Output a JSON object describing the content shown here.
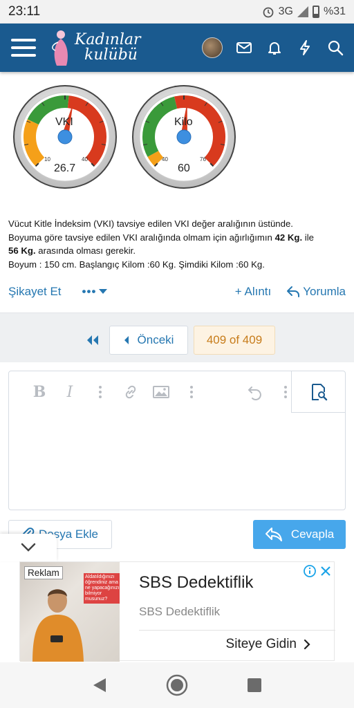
{
  "status_bar": {
    "time": "23:11",
    "network": "3G",
    "battery": "%31"
  },
  "header": {
    "logo_line1": "Kadınlar",
    "logo_line2": "kulübü",
    "brand_color": "#1a5a8f",
    "icons": [
      "menu-icon",
      "avatar",
      "envelope-icon",
      "bell-icon",
      "bolt-icon",
      "search-icon"
    ]
  },
  "gauges": [
    {
      "label": "VKI",
      "min_label": "10",
      "max_label": "40",
      "value": "26.7",
      "needle_fraction": 0.55
    },
    {
      "label": "Kilo",
      "min_label": "40",
      "max_label": "76",
      "value": "60",
      "needle_fraction": 0.52
    }
  ],
  "message": {
    "line1": "Vücut Kitle İndeksim (VKI) tavsiye edilen VKI değer aralığının üstünde.",
    "line2_a": "Boyuma göre tavsiye edilen VKI aralığında olmam için ağırlığımın ",
    "line2_b": "42 Kg.",
    "line2_c": " ile",
    "line3_a": "56 Kg.",
    "line3_b": " arasında olması gerekir.",
    "line4": "Boyum : 150 cm. Başlangıç Kilom :60 Kg. Şimdiki Kilom :60 Kg."
  },
  "actions": {
    "report": "Şikayet Et",
    "more": "•••",
    "quote": "+ Alıntı",
    "reply": "Yorumla"
  },
  "pager": {
    "prev_label": "Önceki",
    "current_label": "409 of 409"
  },
  "editor": {
    "bold": "B",
    "italic": "I"
  },
  "buttons": {
    "attach": "Dosya Ekle",
    "submit": "Cevapla",
    "accent": "#47a7eb"
  },
  "ad": {
    "tag": "Reklam",
    "image_text": "Aldatıldığınızı öğrendiniz ama ne yapacağınızı bilmiyor musunuz?",
    "title": "SBS Dedektiflik",
    "subtitle": "SBS Dedektiflik",
    "cta": "Siteye Gidin"
  }
}
